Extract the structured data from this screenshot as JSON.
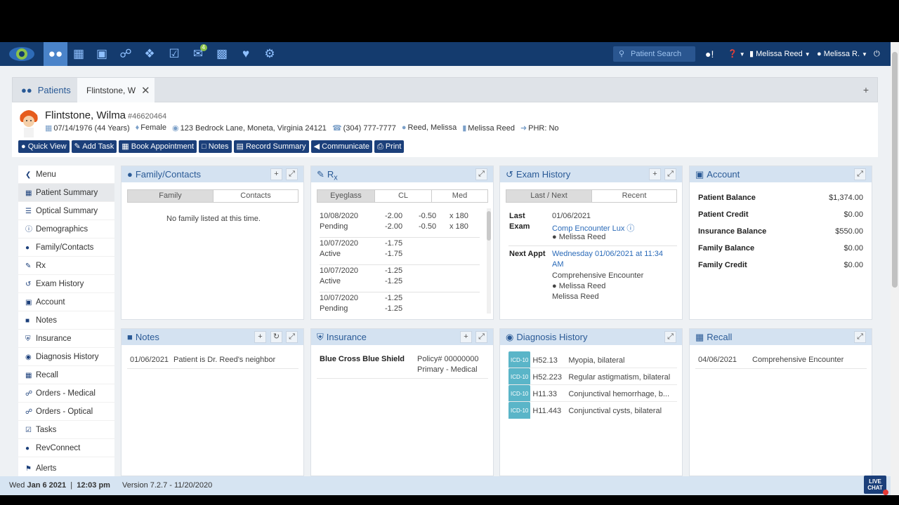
{
  "topnav": {
    "search_placeholder": "Patient Search",
    "badge_count": "4",
    "provider": "Melissa Reed",
    "user": "Melissa R."
  },
  "tabs": {
    "patients": "Patients",
    "current": "Flintstone, W"
  },
  "patient": {
    "name": "Flintstone, Wilma",
    "id": "#46620464",
    "dob": "07/14/1976 (44 Years)",
    "sex": "Female",
    "address": "123 Bedrock Lane, Moneta, Virginia 24121",
    "phone": "(304) 777-7777",
    "provider": "Reed, Melissa",
    "location": "Melissa Reed",
    "phr": "PHR: No"
  },
  "actions": [
    "Quick View",
    "Add Task",
    "Book Appointment",
    "Notes",
    "Record Summary",
    "Communicate",
    "Print"
  ],
  "sidebar": {
    "items": [
      {
        "label": "Menu"
      },
      {
        "label": "Patient Summary"
      },
      {
        "label": "Optical Summary"
      },
      {
        "label": "Demographics"
      },
      {
        "label": "Family/Contacts"
      },
      {
        "label": "Rx"
      },
      {
        "label": "Exam History"
      },
      {
        "label": "Account"
      },
      {
        "label": "Notes"
      },
      {
        "label": "Insurance"
      },
      {
        "label": "Diagnosis History"
      },
      {
        "label": "Recall"
      },
      {
        "label": "Orders - Medical"
      },
      {
        "label": "Orders - Optical"
      },
      {
        "label": "Tasks"
      },
      {
        "label": "RevConnect"
      },
      {
        "label": "Alerts"
      }
    ]
  },
  "family": {
    "title": "Family/Contacts",
    "tab_family": "Family",
    "tab_contacts": "Contacts",
    "empty": "No family listed at this time."
  },
  "rx": {
    "title": "R",
    "title_sub": "x",
    "tab_eyeglass": "Eyeglass",
    "tab_cl": "CL",
    "tab_med": "Med",
    "rows": [
      {
        "date": "10/08/2020",
        "status": "Pending",
        "s1": "-2.00",
        "s2": "-2.00",
        "c1": "-0.50",
        "c2": "-0.50",
        "a1": "x 180",
        "a2": "x 180"
      },
      {
        "date": "10/07/2020",
        "status": "Active",
        "s1": "-1.75",
        "s2": "-1.75",
        "c1": "",
        "c2": "",
        "a1": "",
        "a2": ""
      },
      {
        "date": "10/07/2020",
        "status": "Active",
        "s1": "-1.25",
        "s2": "-1.25",
        "c1": "",
        "c2": "",
        "a1": "",
        "a2": ""
      },
      {
        "date": "10/07/2020",
        "status": "Pending",
        "s1": "-1.25",
        "s2": "-1.25",
        "c1": "",
        "c2": "",
        "a1": "",
        "a2": ""
      }
    ]
  },
  "exam": {
    "title": "Exam History",
    "tab_last": "Last / Next",
    "tab_recent": "Recent",
    "last_label_1": "Last",
    "last_label_2": "Exam",
    "last_date": "01/06/2021",
    "last_type": "Comp Encounter Lux",
    "last_provider": "Melissa Reed",
    "next_label": "Next Appt",
    "next_when_1": "Wednesday 01/06/2021 at 11:34",
    "next_when_2": "AM",
    "next_type": "Comprehensive Encounter",
    "next_provider": "Melissa Reed",
    "next_location": "Melissa Reed"
  },
  "account": {
    "title": "Account",
    "rows": [
      {
        "label": "Patient Balance",
        "value": "$1,374.00"
      },
      {
        "label": "Patient Credit",
        "value": "$0.00"
      },
      {
        "label": "Insurance Balance",
        "value": "$550.00"
      },
      {
        "label": "Family Balance",
        "value": "$0.00"
      },
      {
        "label": "Family Credit",
        "value": "$0.00"
      }
    ]
  },
  "notes": {
    "title": "Notes",
    "date": "01/06/2021",
    "text": "Patient is Dr. Reed's neighbor"
  },
  "insurance": {
    "title": "Insurance",
    "carrier": "Blue Cross Blue Shield",
    "policy": "Policy# 00000000",
    "type": "Primary - Medical"
  },
  "diagnosis": {
    "title": "Diagnosis History",
    "badge": "ICD-10",
    "rows": [
      {
        "code": "H52.13",
        "desc": "Myopia, bilateral"
      },
      {
        "code": "H52.223",
        "desc": "Regular astigmatism, bilateral"
      },
      {
        "code": "H11.33",
        "desc": "Conjunctival hemorrhage, b..."
      },
      {
        "code": "H11.443",
        "desc": "Conjunctival cysts, bilateral"
      }
    ]
  },
  "recall": {
    "title": "Recall",
    "date": "04/06/2021",
    "type": "Comprehensive Encounter"
  },
  "status": {
    "day": "Wed",
    "date": "Jan 6 2021",
    "time": "12:03 pm",
    "version": "Version 7.2.7 - 11/20/2020"
  },
  "livechat": {
    "line1": "LIVE",
    "line2": "CHAT"
  },
  "colors": {
    "nav": "#143b6e",
    "accent": "#4a83c9",
    "button": "#1b3f7a",
    "panel_header": "#d4e2f1"
  }
}
